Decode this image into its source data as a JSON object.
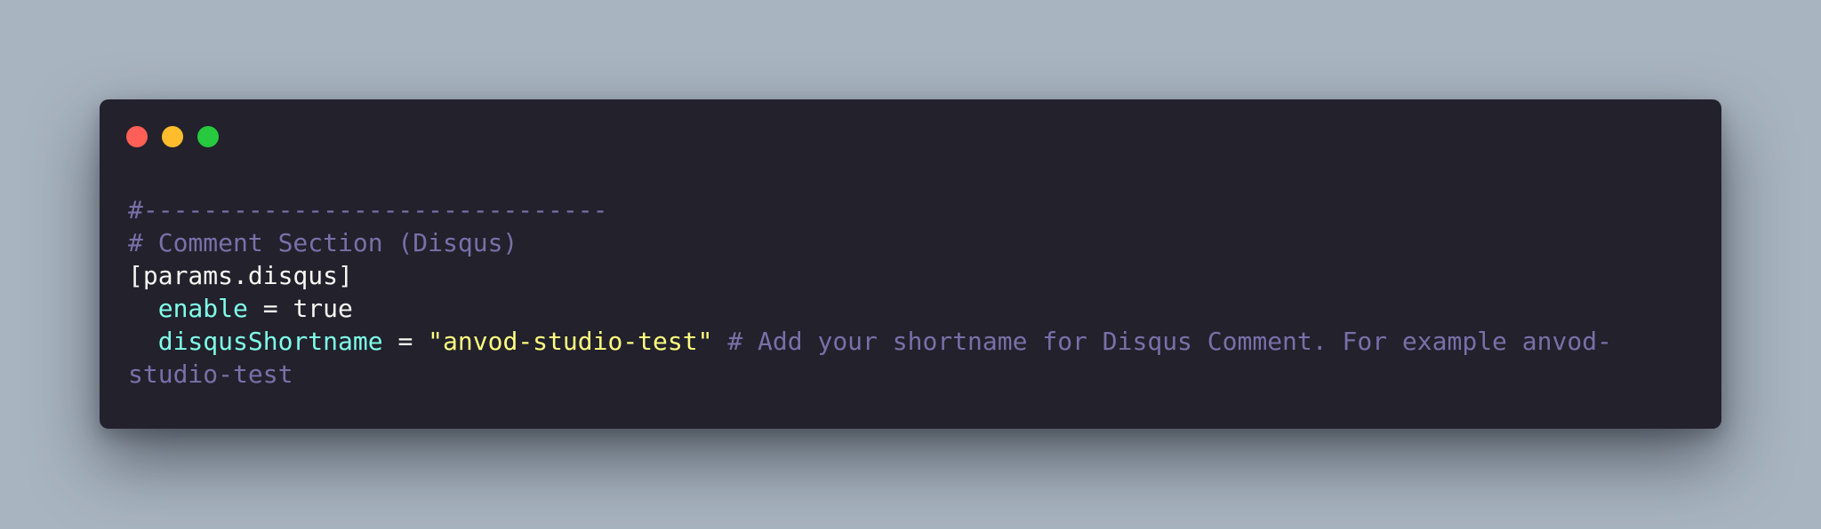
{
  "window": {
    "controls": [
      {
        "name": "close",
        "color": "#ff5f56"
      },
      {
        "name": "minimize",
        "color": "#ffbd2e"
      },
      {
        "name": "maximize",
        "color": "#27c93f"
      }
    ]
  },
  "colors": {
    "background": "#a8b4c0",
    "window_bg": "#22212c",
    "comment": "#7970a9",
    "plain": "#f8f8f2",
    "key": "#80ffea",
    "string": "#ffff80"
  },
  "code": {
    "line1": "#-------------------------------",
    "line2": "# Comment Section (Disqus)",
    "line3": "[params.disqus]",
    "line4_indent": "  ",
    "line4_key": "enable",
    "line4_op": " = ",
    "line4_value": "true",
    "line5_indent": "  ",
    "line5_key": "disqusShortname",
    "line5_op": " = ",
    "line5_string": "\"anvod-studio-test\"",
    "line5_comment": " # Add your shortname for Disqus Comment. For example anvod-",
    "line6": "studio-test"
  }
}
